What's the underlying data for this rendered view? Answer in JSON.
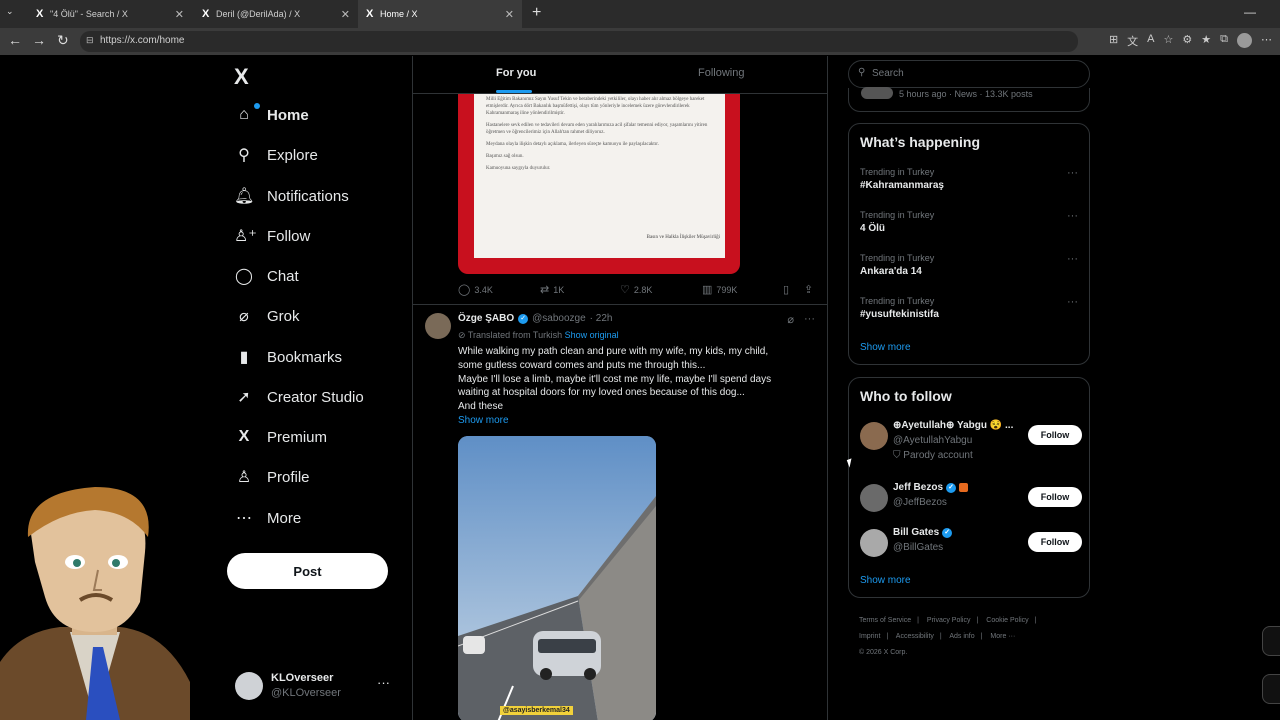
{
  "browser": {
    "tabs": [
      {
        "title": "\"4 Ölü\" - Search / X",
        "icon": "X"
      },
      {
        "title": "Deril (@DerilAda) / X",
        "icon": "X"
      },
      {
        "title": "Home / X",
        "icon": "X"
      }
    ],
    "new_tab": "+",
    "url": "https://x.com/home",
    "minimize": "—"
  },
  "nav": {
    "logo": "X",
    "items": [
      {
        "label": "Home",
        "icon": "home-icon",
        "glyph": "⌂"
      },
      {
        "label": "Explore",
        "icon": "search-icon",
        "glyph": "⚲"
      },
      {
        "label": "Notifications",
        "icon": "bell-icon",
        "glyph": "♫"
      },
      {
        "label": "Follow",
        "icon": "add-person-icon",
        "glyph": "♙"
      },
      {
        "label": "Chat",
        "icon": "chat-icon",
        "glyph": "◯"
      },
      {
        "label": "Grok",
        "icon": "grok-icon",
        "glyph": "⌀"
      },
      {
        "label": "Bookmarks",
        "icon": "bookmark-icon",
        "glyph": "▮"
      },
      {
        "label": "Creator Studio",
        "icon": "rocket-icon",
        "glyph": "➚"
      },
      {
        "label": "Premium",
        "icon": "x-icon",
        "glyph": "X"
      },
      {
        "label": "Profile",
        "icon": "person-icon",
        "glyph": "♙"
      },
      {
        "label": "More",
        "icon": "more-circle-icon",
        "glyph": "⋯"
      }
    ],
    "post_label": "Post",
    "account": {
      "name": "KLOverseer",
      "handle": "@KLOverseer",
      "more": "···"
    }
  },
  "feed": {
    "tabs": {
      "for_you": "For you",
      "following": "Following"
    },
    "doc_paragraphs": [
      "Milli Eğitim Bakanımız Sayın Yusuf Tekin ve beraberindeki yetkililer, olayı haber alır almaz bölgeye hareket etmişlerdir. Ayrıca dört Bakanlık başmüfettişi, olayı tüm yönleriyle incelemek üzere görevlendirilerek Kahramanmaraş iline yönlendirilmiştir.",
      "Hastanelere sevk edilen ve tedavileri devam eden yaralılarımıza acil şifalar temenni ediyor, yaşamlarını yitiren öğretmen ve öğrencilerimiz için Allah'tan rahmet diliyoruz.",
      "Meydana olayla ilişkin detaylı açıklama, ilerleyen süreçte kamuoyu ile paylaşılacaktır.",
      "Başımız sağ olsun.",
      "Kamuoyuna saygıyla duyurulur."
    ],
    "doc_signature": "Basın ve Halkla İlişkiler Müşavirliği",
    "prev_actions": {
      "replies": "3.4K",
      "reposts": "1K",
      "likes": "2.8K",
      "views": "799K"
    },
    "tweet": {
      "name": "Özge ŞABO",
      "handle": "@saboozge",
      "time": "· 22h",
      "translated": "Translated from Turkish",
      "show_original": "Show original",
      "body": [
        "While walking my path clean and pure with my wife, my kids, my child,",
        "some gutless coward comes and puts me through this...",
        "Maybe I'll lose a limb, maybe it'll cost me my life, maybe I'll spend days",
        "waiting at hospital doors for my loved ones because of this dog...",
        "And these"
      ],
      "show_more": "Show more",
      "video_tag": "@asayisberkemal34"
    }
  },
  "right": {
    "search_placeholder": "Search",
    "peek_text": "5 hours ago · News · 13.3K posts",
    "happening": {
      "title": "What’s happening",
      "trends": [
        {
          "category": "Trending in Turkey",
          "topic": "#Kahramanmaraş"
        },
        {
          "category": "Trending in Turkey",
          "topic": "4 Ölü"
        },
        {
          "category": "Trending in Turkey",
          "topic": "Ankara'da 14"
        },
        {
          "category": "Trending in Turkey",
          "topic": "#yusuftekinistifa"
        }
      ],
      "show_more": "Show more"
    },
    "who_to_follow": {
      "title": "Who to follow",
      "people": [
        {
          "name": "⊕Ayetullah⊕ Yabgu 😵 ...",
          "handle": "@AyetullahYabgu",
          "parody": "Parody account",
          "follow": "Follow"
        },
        {
          "name": "Jeff Bezos",
          "handle": "@JeffBezos",
          "follow": "Follow"
        },
        {
          "name": "Bill Gates",
          "handle": "@BillGates",
          "follow": "Follow"
        }
      ],
      "show_more": "Show more"
    },
    "footer": [
      "Terms of Service",
      "|",
      "Privacy Policy",
      "|",
      "Cookie Policy",
      "|",
      "Imprint",
      "|",
      "Accessibility",
      "|",
      "Ads info",
      "|",
      "More ···",
      "© 2026 X Corp."
    ]
  },
  "colors": {
    "accent": "#1d9bf0",
    "background": "#000000",
    "border": "#2f3336",
    "muted": "#71767b",
    "text": "#e7e9ea"
  }
}
